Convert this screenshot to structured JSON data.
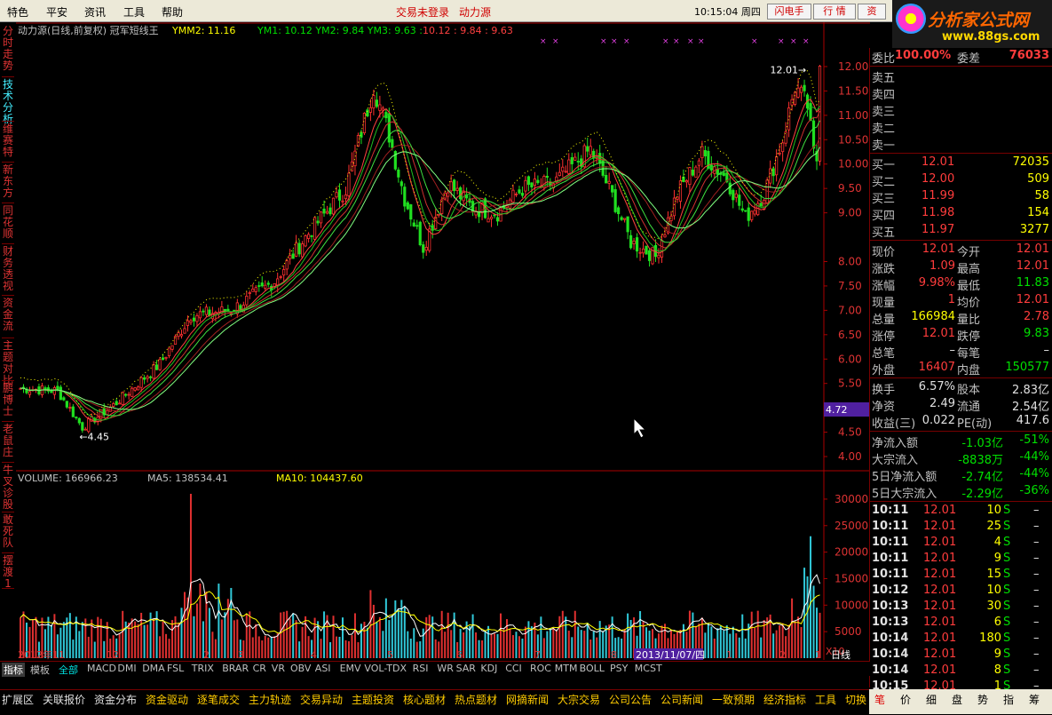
{
  "menu": {
    "items": [
      "特色",
      "平安",
      "资讯",
      "工具",
      "帮助"
    ],
    "login": "交易未登录",
    "stock_name": "动力源",
    "time": "10:15:04 周四",
    "btn_flash": "闪电手",
    "btn_quote": "行  情",
    "btn_info": "资"
  },
  "logo": {
    "title": "分析家公式网",
    "url": "www.88gs.com"
  },
  "left_tabs": [
    "分时走势",
    "技术分析",
    "维赛特",
    "新东方",
    "同花顺",
    "财务透视",
    "资金流",
    "主题对比",
    "鹏博士",
    "老鼠庄",
    "牛叉诊股",
    "敢死队",
    "摆渡1"
  ],
  "chart_header": {
    "title": "动力源(日线,前复权) 冠军短线王",
    "ymm2": "YMM2: 11.16",
    "ym": "YM1: 10.12  YM2: 9.84  YM3: 9.63 :",
    "red_vals": "10.12 : 9.84 : 9.63"
  },
  "vol_header": {
    "volume": "VOLUME: 166966.23",
    "ma5": "MA5: 138534.41",
    "ma10": "MA10: 104437.60"
  },
  "annotations": {
    "high": "12.01",
    "low": "4.45",
    "cursor_price": "4.72",
    "scale": "X10"
  },
  "price_ticks": [
    "12.00",
    "11.50",
    "11.00",
    "10.50",
    "10.00",
    "9.50",
    "9.00",
    "8.00",
    "7.50",
    "7.00",
    "6.50",
    "6.00",
    "5.50",
    "5.00",
    "4.50",
    "4.00"
  ],
  "vol_ticks": [
    "30000",
    "25000",
    "20000",
    "15000",
    "10000",
    "5000"
  ],
  "date_axis": {
    "labels": [
      "2012年11",
      "12",
      "2",
      "3",
      "4",
      "5",
      "6",
      "7",
      "8",
      "9",
      "10",
      "2013/11/07/四",
      "1",
      "2",
      "1"
    ],
    "period": "日线"
  },
  "chart_data": {
    "type": "candlestick",
    "title": "动力源(日线,前复权) 冠军短线王",
    "ylim": [
      3.8,
      12.4
    ],
    "anchors": [
      [
        0,
        5.4
      ],
      [
        12,
        5.35
      ],
      [
        20,
        4.6
      ],
      [
        30,
        5.05
      ],
      [
        45,
        5.9
      ],
      [
        55,
        6.9
      ],
      [
        68,
        7.0
      ],
      [
        82,
        7.6
      ],
      [
        92,
        8.5
      ],
      [
        105,
        9.5
      ],
      [
        114,
        11.6
      ],
      [
        119,
        10.6
      ],
      [
        124,
        9.3
      ],
      [
        130,
        8.3
      ],
      [
        138,
        9.6
      ],
      [
        146,
        9.1
      ],
      [
        154,
        9.0
      ],
      [
        162,
        9.5
      ],
      [
        172,
        9.6
      ],
      [
        184,
        10.3
      ],
      [
        190,
        9.5
      ],
      [
        197,
        8.4
      ],
      [
        205,
        8.1
      ],
      [
        212,
        9.4
      ],
      [
        220,
        10.2
      ],
      [
        228,
        9.7
      ],
      [
        234,
        8.9
      ],
      [
        240,
        9.4
      ],
      [
        246,
        10.5
      ],
      [
        250,
        11.6
      ],
      [
        254,
        11.2
      ],
      [
        256,
        10.2
      ],
      [
        258,
        10.0
      ]
    ],
    "low_mark": 4.45,
    "high_mark": 12.01,
    "volume_ylim": [
      0,
      32000
    ]
  },
  "quote": {
    "weibi_lbl": "委比",
    "weibi": "100.00%",
    "weicha_lbl": "委差",
    "weicha": "76033",
    "sell": [
      [
        "卖五",
        ""
      ],
      [
        "卖四",
        ""
      ],
      [
        "卖三",
        ""
      ],
      [
        "卖二",
        ""
      ],
      [
        "卖一",
        ""
      ]
    ],
    "buy": [
      [
        "买一",
        "12.01",
        "72035"
      ],
      [
        "买二",
        "12.00",
        "509"
      ],
      [
        "买三",
        "11.99",
        "58"
      ],
      [
        "买四",
        "11.98",
        "154"
      ],
      [
        "买五",
        "11.97",
        "3277"
      ]
    ],
    "stats": [
      [
        "现价",
        "12.01",
        "今开",
        "12.01"
      ],
      [
        "涨跌",
        "1.09",
        "最高",
        "12.01"
      ],
      [
        "涨幅",
        "9.98%",
        "最低",
        "11.83"
      ],
      [
        "现量",
        "1",
        "均价",
        "12.01"
      ],
      [
        "总量",
        "166984",
        "量比",
        "2.78"
      ],
      [
        "涨停",
        "12.01",
        "跌停",
        "9.83"
      ],
      [
        "总笔",
        "–",
        "每笔",
        "–"
      ],
      [
        "外盘",
        "16407",
        "内盘",
        "150577"
      ]
    ],
    "fund": [
      [
        "换手",
        "6.57%",
        "股本",
        "2.83亿"
      ],
      [
        "净资",
        "2.49",
        "流通",
        "2.54亿"
      ],
      [
        "收益(三)",
        "0.022",
        "PE(动)",
        "417.6"
      ]
    ],
    "flow": [
      [
        "净流入额",
        "-1.03亿",
        "-51%"
      ],
      [
        "大宗流入",
        "-8838万",
        "-44%"
      ],
      [
        "5日净流入额",
        "-2.74亿",
        "-44%"
      ],
      [
        "5日大宗流入",
        "-2.29亿",
        "-36%"
      ]
    ],
    "ticks": [
      [
        "10:11",
        "12.01",
        "10",
        "S",
        "–"
      ],
      [
        "10:11",
        "12.01",
        "25",
        "S",
        "–"
      ],
      [
        "10:11",
        "12.01",
        "4",
        "S",
        "–"
      ],
      [
        "10:11",
        "12.01",
        "9",
        "S",
        "–"
      ],
      [
        "10:11",
        "12.01",
        "15",
        "S",
        "–"
      ],
      [
        "10:12",
        "12.01",
        "10",
        "S",
        "–"
      ],
      [
        "10:13",
        "12.01",
        "30",
        "S",
        "–"
      ],
      [
        "10:13",
        "12.01",
        "6",
        "S",
        "–"
      ],
      [
        "10:14",
        "12.01",
        "180",
        "S",
        "–"
      ],
      [
        "10:14",
        "12.01",
        "9",
        "S",
        "–"
      ],
      [
        "10:14",
        "12.01",
        "8",
        "S",
        "–"
      ],
      [
        "10:15",
        "12.01",
        "1",
        "S",
        "–"
      ]
    ]
  },
  "indicator_tabs": [
    "指标",
    "模板",
    "全部",
    "MACD",
    "DMI",
    "DMA",
    "FSL",
    "TRIX",
    "BRAR",
    "CR",
    "VR",
    "OBV",
    "ASI",
    "EMV",
    "VOL-TDX",
    "RSI",
    "WR",
    "SAR",
    "KDJ",
    "CCI",
    "ROC",
    "MTM",
    "BOLL",
    "PSY",
    "MCST"
  ],
  "status_tabs": [
    "扩展区",
    "关联报价",
    "资金分布",
    "资金驱动",
    "逐笔成交",
    "主力轨迹",
    "交易异动",
    "主题投资",
    "核心题材",
    "热点题材",
    "网摘新闻",
    "大宗交易",
    "公司公告",
    "公司新闻",
    "一致预期",
    "经济指标",
    "工具",
    "切换"
  ],
  "right_bottom_tabs": [
    "笔",
    "价",
    "细",
    "盘",
    "势",
    "指",
    "筹"
  ]
}
